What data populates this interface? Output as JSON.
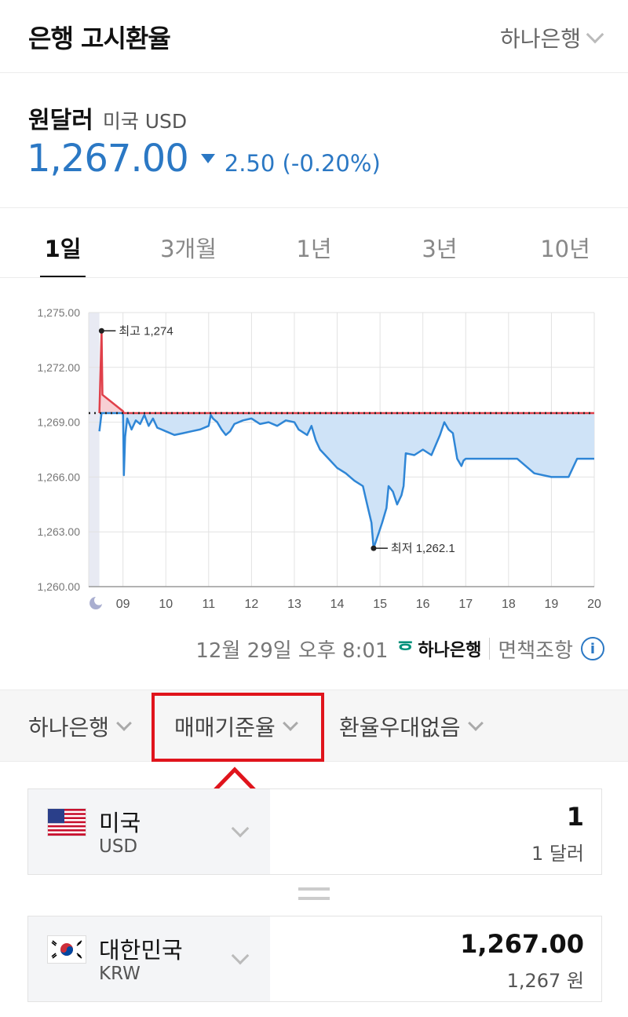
{
  "header": {
    "title": "은행 고시환율",
    "bank_selector": "하나은행"
  },
  "pair": {
    "name": "원달러",
    "sub": "미국 USD"
  },
  "rate": {
    "value": "1,267.00",
    "change": "2.50 (-0.20%)",
    "direction": "down",
    "color": "#2b78c4"
  },
  "tabs": [
    {
      "label": "1일",
      "active": true
    },
    {
      "label": "3개월",
      "active": false
    },
    {
      "label": "1년",
      "active": false
    },
    {
      "label": "3년",
      "active": false
    },
    {
      "label": "10년",
      "active": false
    }
  ],
  "chart_data": {
    "type": "line",
    "title": "",
    "x_ticks": [
      "09",
      "10",
      "11",
      "12",
      "13",
      "14",
      "15",
      "16",
      "17",
      "18",
      "19",
      "20"
    ],
    "ylim": [
      1260,
      1275
    ],
    "y_ticks": [
      "1,260.00",
      "1,263.00",
      "1,266.00",
      "1,269.00",
      "1,272.00",
      "1,275.00"
    ],
    "reference_line": 1269.5,
    "annotations": [
      {
        "label": "최고 1,274",
        "x": 8.5,
        "y": 1274
      },
      {
        "label": "최저 1,262.1",
        "x": 14.85,
        "y": 1262.1
      }
    ],
    "series": [
      {
        "x": [
          8.45,
          8.5,
          8.52,
          9.0,
          9.02,
          9.05,
          9.1,
          9.2,
          9.3,
          9.4,
          9.5,
          9.6,
          9.7,
          9.8,
          9.9,
          10.0,
          10.2,
          10.4,
          10.6,
          10.8,
          11.0,
          11.05,
          11.1,
          11.2,
          11.3,
          11.4,
          11.5,
          11.6,
          11.8,
          12.0,
          12.2,
          12.4,
          12.6,
          12.8,
          13.0,
          13.1,
          13.3,
          13.4,
          13.5,
          13.6,
          13.8,
          14.0,
          14.2,
          14.4,
          14.6,
          14.7,
          14.8,
          14.85,
          14.95,
          15.05,
          15.15,
          15.2,
          15.3,
          15.4,
          15.5,
          15.55,
          15.6,
          15.8,
          16.0,
          16.2,
          16.4,
          16.5,
          16.6,
          16.7,
          16.8,
          16.9,
          16.95,
          17.0,
          17.5,
          18.0,
          18.2,
          18.6,
          19.0,
          19.2,
          19.4,
          19.6,
          19.8,
          20.0
        ],
        "y": [
          1268.5,
          1274,
          1270.5,
          1269.6,
          1266.1,
          1268.2,
          1269.2,
          1268.6,
          1269.1,
          1268.9,
          1269.4,
          1268.8,
          1269.2,
          1268.7,
          1268.6,
          1268.5,
          1268.3,
          1268.4,
          1268.5,
          1268.6,
          1268.8,
          1269.4,
          1269.2,
          1269.0,
          1268.6,
          1268.3,
          1268.5,
          1268.9,
          1269.1,
          1269.2,
          1268.9,
          1269.0,
          1268.8,
          1269.1,
          1269.0,
          1268.6,
          1268.3,
          1268.8,
          1268.0,
          1267.5,
          1267.0,
          1266.5,
          1266.2,
          1265.8,
          1265.5,
          1264.5,
          1263.5,
          1262.1,
          1262.8,
          1263.5,
          1264.3,
          1265.5,
          1265.2,
          1264.5,
          1265.0,
          1265.5,
          1267.3,
          1267.2,
          1267.5,
          1267.2,
          1268.3,
          1269.0,
          1268.6,
          1268.4,
          1267.0,
          1266.6,
          1266.9,
          1267.0,
          1267.0,
          1267.0,
          1267.0,
          1266.2,
          1266.0,
          1266.0,
          1266.0,
          1267.0,
          1267.0,
          1267.0
        ]
      }
    ]
  },
  "source": {
    "timestamp": "12월 29일 오후 8:01",
    "bank_logo": "하나은행",
    "disclaimer": "면책조항",
    "info_icon": "i"
  },
  "filters": [
    {
      "label": "하나은행"
    },
    {
      "label": "매매기준율"
    },
    {
      "label": "환율우대없음"
    }
  ],
  "from": {
    "name": "미국",
    "code": "USD",
    "amount": "1",
    "amount_sub": "1 달러",
    "flag": "us-flag"
  },
  "to": {
    "name": "대한민국",
    "code": "KRW",
    "amount": "1,267.00",
    "amount_sub": "1,267 원",
    "flag": "kr-flag"
  },
  "colors": {
    "up": "#e0404a",
    "down": "#2b78c4",
    "highlight_box": "#e0141c"
  }
}
